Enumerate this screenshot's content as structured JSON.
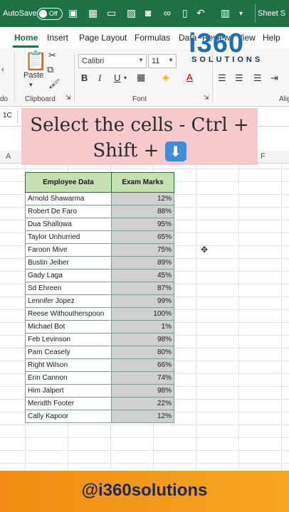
{
  "titlebar": {
    "autosave_label": "AutoSave",
    "autosave_state": "Off",
    "sheet_name": "Sheet S"
  },
  "ribbon_tabs": [
    "Home",
    "Insert",
    "Page Layout",
    "Formulas",
    "Data",
    "Review",
    "View",
    "Help"
  ],
  "ribbon": {
    "font_name": "Calibri",
    "font_size": "11",
    "paste_label": "Paste",
    "clipboard_group": "Clipboard",
    "font_group": "Font",
    "alignment_group_partial": "Alig",
    "left_group_partial": "do"
  },
  "logo": {
    "brand": "i360",
    "tagline": "SOLUTIONS"
  },
  "formula_bar": {
    "name_box": "1C"
  },
  "columns": {
    "a": "A",
    "f": "F"
  },
  "caption": {
    "line1": "Select the cells - Ctrl +",
    "line2": "Shift + ",
    "key_glyph": "⬇"
  },
  "table": {
    "headers": [
      "Employee Data",
      "Exam Marks"
    ],
    "rows": [
      [
        "Arnold Shawarma",
        "12%"
      ],
      [
        "Robert De Faro",
        "88%"
      ],
      [
        "Dua Shallowa",
        "95%"
      ],
      [
        "Taylor Unhurried",
        "65%"
      ],
      [
        "Faroon Mive",
        "75%"
      ],
      [
        "Bustin Jeiber",
        "89%"
      ],
      [
        "Gady Laga",
        "45%"
      ],
      [
        "Sd Ehreen",
        "87%"
      ],
      [
        "Lennifer Jopez",
        "99%"
      ],
      [
        "Reese Withoutherspoon",
        "100%"
      ],
      [
        "Michael Bot",
        "1%"
      ],
      [
        "Feb Levinson",
        "98%"
      ],
      [
        "Pam Ceasely",
        "80%"
      ],
      [
        "Right Wilson",
        "66%"
      ],
      [
        "Erin Cannon",
        "74%"
      ],
      [
        "Him Jalpert",
        "98%"
      ],
      [
        "Meridth Footer",
        "22%"
      ],
      [
        "Cally Kapoor",
        "12%"
      ]
    ]
  },
  "footer": {
    "handle": "@i360solutions"
  },
  "colors": {
    "excel_green": "#1e7145",
    "header_fill": "#c6e0b4",
    "selection_gray": "#d0d0d0",
    "caption_pink": "#f6c9cd",
    "banner_orange": "#f5a623",
    "logo_blue": "#1c6fb4"
  }
}
